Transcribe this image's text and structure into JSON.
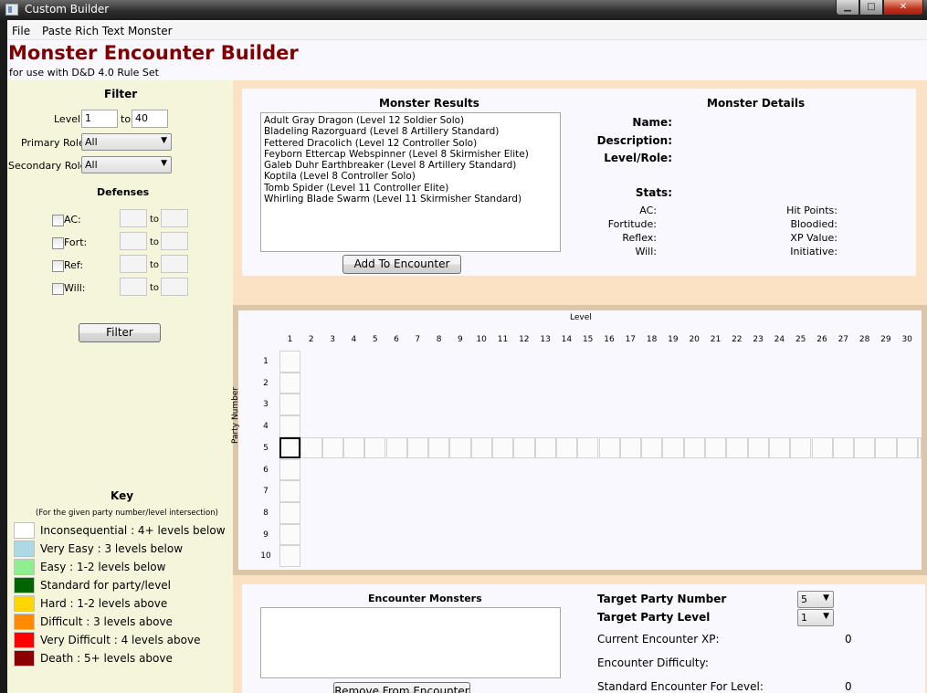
{
  "window": {
    "title": "Custom Builder",
    "min_label": "▁",
    "max_label": "□",
    "close_label": "✕"
  },
  "menu": {
    "file": "File",
    "paste": "Paste Rich Text Monster"
  },
  "header": {
    "title": "Monster Encounter Builder",
    "subtitle": "for use with D&D 4.0 Rule Set"
  },
  "filter": {
    "heading": "Filter",
    "level_label": "Level:",
    "level_from": "1",
    "level_to_label": "to",
    "level_to": "40",
    "primary_label": "Primary Role:",
    "primary_value": "All",
    "secondary_label": "Secondary Role:",
    "secondary_value": "All",
    "defenses_heading": "Defenses",
    "defenses": [
      {
        "label": "AC:",
        "to": "to"
      },
      {
        "label": "Fort:",
        "to": "to"
      },
      {
        "label": "Ref:",
        "to": "to"
      },
      {
        "label": "Will:",
        "to": "to"
      }
    ],
    "button": "Filter"
  },
  "key": {
    "heading": "Key",
    "note": "(For the given party number/level intersection)",
    "items": [
      {
        "label": "Inconsequential : 4+ levels below",
        "color": "#ffffff"
      },
      {
        "label": "Very Easy : 3 levels below",
        "color": "#add8e6"
      },
      {
        "label": "Easy : 1-2 levels below",
        "color": "#90ee90"
      },
      {
        "label": "Standard for party/level",
        "color": "#006400"
      },
      {
        "label": "Hard : 1-2 levels above",
        "color": "#ffd700"
      },
      {
        "label": "Difficult : 3 levels above",
        "color": "#ff8c00"
      },
      {
        "label": "Very Difficult : 4 levels above",
        "color": "#ff0000"
      },
      {
        "label": "Death : 5+ levels above",
        "color": "#8b0000"
      }
    ]
  },
  "results": {
    "heading": "Monster Results",
    "items": [
      "Adult Gray Dragon (Level 12 Soldier Solo)",
      "Bladeling Razorguard (Level 8 Artillery Standard)",
      "Fettered Dracolich (Level 12 Controller Solo)",
      "Feyborn Ettercap Webspinner (Level 8 Skirmisher Elite)",
      "Galeb Duhr Earthbreaker (Level 8 Artillery Standard)",
      "Koptila (Level 8 Controller Solo)",
      "Tomb Spider (Level 11 Controller Elite)",
      "Whirling Blade Swarm (Level 11 Skirmisher Standard)"
    ],
    "add_button": "Add To Encounter"
  },
  "details": {
    "heading": "Monster Details",
    "name_label": "Name:",
    "description_label": "Description:",
    "level_role_label": "Level/Role:",
    "stats_label": "Stats:",
    "left_stats": [
      "AC:",
      "Fortitude:",
      "Reflex:",
      "Will:"
    ],
    "right_stats": [
      "Hit Points:",
      "Bloodied:",
      "XP Value:",
      "Initiative:"
    ]
  },
  "grid": {
    "level_title": "Level",
    "party_title": "Party Number",
    "columns": [
      "1",
      "2",
      "3",
      "4",
      "5",
      "6",
      "7",
      "8",
      "9",
      "10",
      "11",
      "12",
      "13",
      "14",
      "15",
      "16",
      "17",
      "18",
      "19",
      "20",
      "21",
      "22",
      "23",
      "24",
      "25",
      "26",
      "27",
      "28",
      "29",
      "30"
    ],
    "rows": [
      "1",
      "2",
      "3",
      "4",
      "5",
      "6",
      "7",
      "8",
      "9",
      "10"
    ],
    "selected_party": 5,
    "selected_level": 1
  },
  "encounter": {
    "heading": "Encounter Monsters",
    "remove_button": "Remove From Encounter",
    "target_party_label": "Target Party Number",
    "target_party_value": "5",
    "target_level_label": "Target Party Level",
    "target_level_value": "1",
    "current_xp_label": "Current Encounter XP:",
    "current_xp_value": "0",
    "difficulty_label": "Encounter Difficulty:",
    "standard_label": "Standard Encounter For Level:",
    "standard_value": "0"
  }
}
